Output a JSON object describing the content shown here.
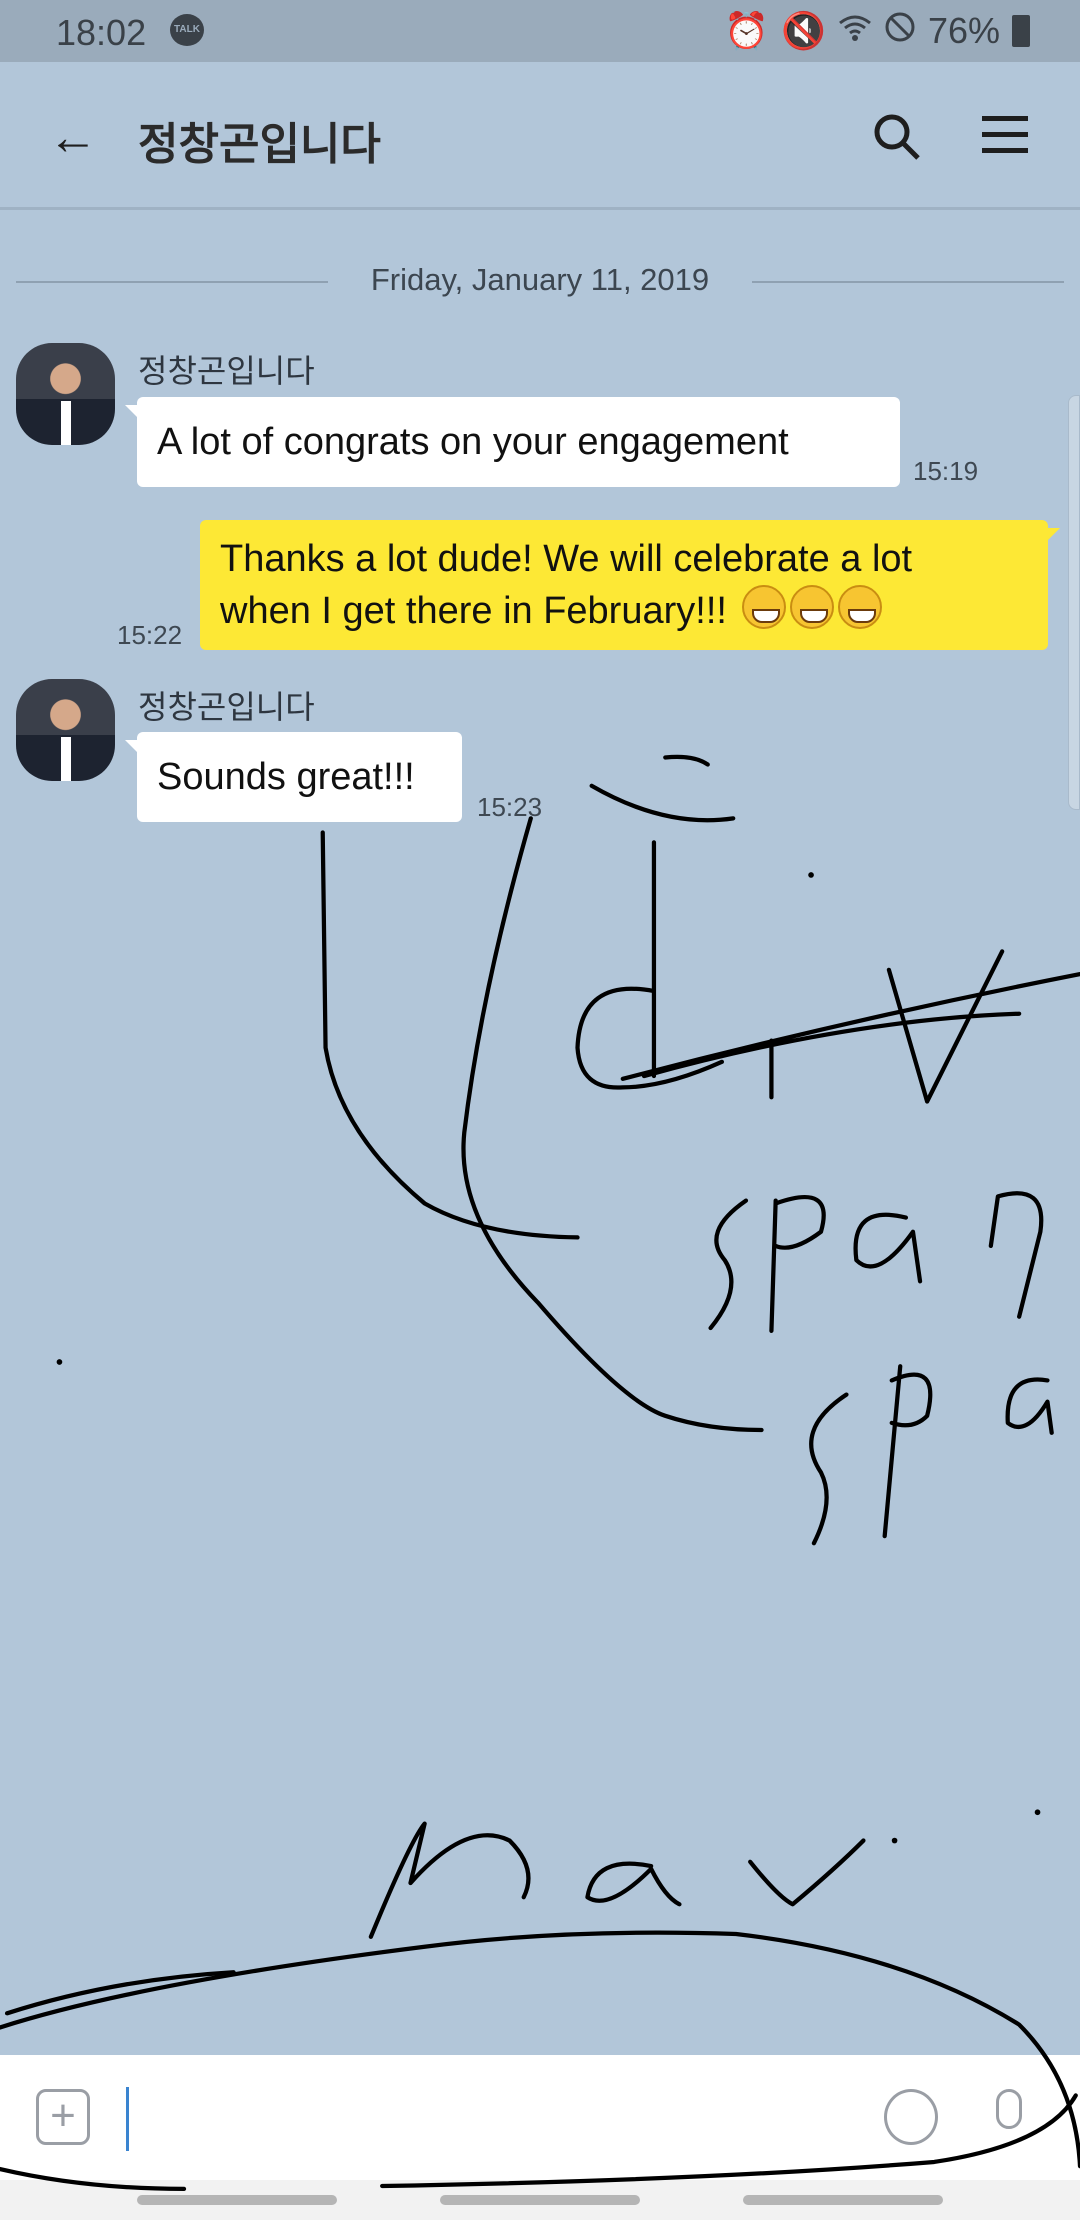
{
  "status_bar": {
    "time": "18:02",
    "talk_badge": "TALK",
    "battery": "76%",
    "icons": [
      "alarm-icon",
      "mute-icon",
      "wifi-icon",
      "do-not-disturb-icon",
      "battery-charging-icon"
    ]
  },
  "header": {
    "title": "정창곤입니다"
  },
  "date_divider": "Friday, January 11, 2019",
  "messages": [
    {
      "sender": "정창곤입니다",
      "text": "A lot of congrats on your engagement",
      "time": "15:19",
      "direction": "in"
    },
    {
      "text_line1": "Thanks a lot dude! We will celebrate a lot",
      "text_line2": "when I get there in February!!!",
      "emoji": "😁😁😁",
      "time": "15:22",
      "direction": "out"
    },
    {
      "sender": "정창곤입니다",
      "text": "Sounds great!!!",
      "time": "15:23",
      "direction": "in"
    }
  ],
  "input": {
    "value": ""
  },
  "colors": {
    "background": "#b2c6d9",
    "outgoing": "#fde835",
    "incoming": "#ffffff",
    "status_bar": "#9aabbb"
  }
}
